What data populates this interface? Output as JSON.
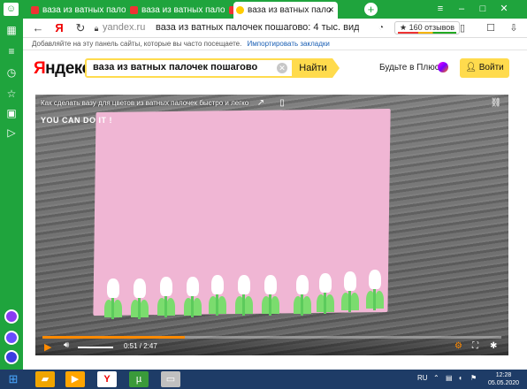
{
  "tabs": [
    {
      "label": "ваза из ватных палочек",
      "favicon_color": "#e33"
    },
    {
      "label": "ваза из ватных палочек",
      "favicon_color": "#e33"
    },
    {
      "label": "ваза из ватных палочек",
      "favicon_color": "#e33"
    },
    {
      "label": "ваза из ватных пало",
      "favicon_color": "#ffcc00"
    }
  ],
  "addressbar": {
    "domain": "yandex.ru",
    "title": "ваза из ватных палочек пошагово: 4 тыс. видео н...",
    "reviews": "★ 160 отзывов"
  },
  "bookmarks_bar": {
    "hint": "Добавляйте на эту панель сайты, которые вы часто посещаете.",
    "import_link": "Импортировать закладки"
  },
  "header": {
    "logo": "Яндекс",
    "query": "ваза из ватных палочек пошагово",
    "find_label": "Найти",
    "plus_label": "Будьте в Плюсе",
    "login_label": "Войти"
  },
  "video": {
    "title": "Как сделать вазу для цветов из ватных палочек быстро и легко",
    "brand": "YOU CAN DO IT !",
    "time": "0:51 / 2:47",
    "progress_fraction": 0.31
  },
  "taskbar": {
    "lang": "RU",
    "time": "12:28",
    "date": "05.05.2020"
  },
  "colors": {
    "browser_green": "#1fa43d",
    "yandex_yellow": "#ffdb4d",
    "taskbar": "#1e3c67",
    "progress": "#ff8a00"
  }
}
